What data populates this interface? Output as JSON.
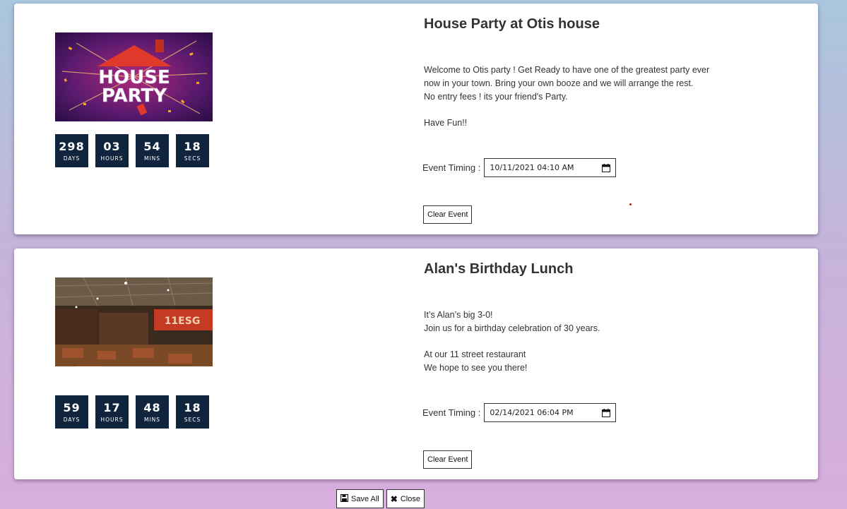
{
  "events": [
    {
      "title": "House Party at Otis house",
      "image_text": [
        "HOUSE",
        "PARTY"
      ],
      "countdown": [
        {
          "value": "298",
          "label": "DAYS"
        },
        {
          "value": "03",
          "label": "HOURS"
        },
        {
          "value": "54",
          "label": "MINS"
        },
        {
          "value": "18",
          "label": "SECS"
        }
      ],
      "description": [
        "Welcome to Otis party ! Get Ready to have one of the greatest party ever",
        "now in your town. Bring your own booze and we will arrange the rest.",
        "No entry fees ! its your friend's Party.",
        "",
        "Have Fun!!"
      ],
      "timing_label": "Event Timing :",
      "timing_value": "10/11/2021 04:10 AM",
      "clear_label": "Clear Event"
    },
    {
      "title": "Alan's Birthday Lunch",
      "image_text": [
        "11ESG"
      ],
      "countdown": [
        {
          "value": "59",
          "label": "DAYS"
        },
        {
          "value": "17",
          "label": "HOURS"
        },
        {
          "value": "48",
          "label": "MINS"
        },
        {
          "value": "18",
          "label": "SECS"
        }
      ],
      "description": [
        "It’s Alan’s big 3-0!",
        "Join us for a birthday celebration of 30 years.",
        "",
        "At our 11 street restaurant",
        "We hope to see you there!"
      ],
      "timing_label": "Event Timing :",
      "timing_value": "02/14/2021 06:04 PM",
      "clear_label": "Clear Event"
    }
  ],
  "footer": {
    "save_label": "Save All",
    "close_label": "Close",
    "save_icon": "floppy-disk-icon",
    "close_icon": "close-icon"
  },
  "colors": {
    "countdown_bg": "#10253d",
    "accent_dot": "#cc1111"
  }
}
